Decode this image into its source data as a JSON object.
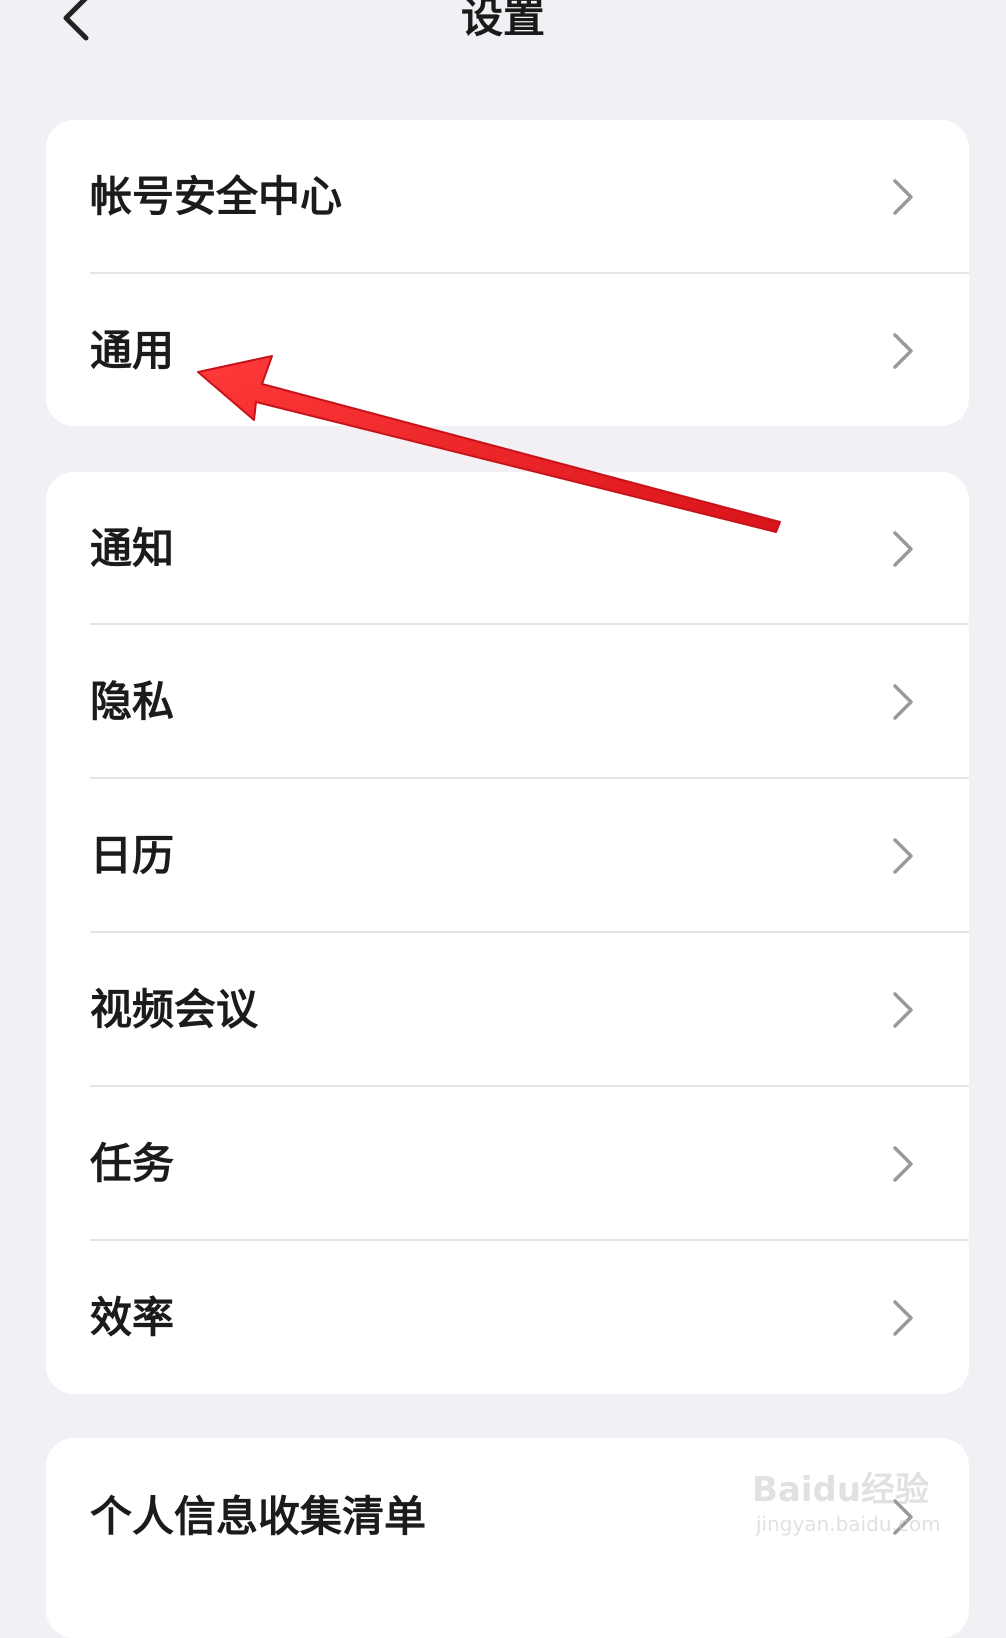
{
  "header": {
    "title": "设置",
    "back_icon": "chevron-left-icon"
  },
  "sections": [
    {
      "items": [
        {
          "label": "帐号安全中心",
          "icon": "chevron-right-icon"
        },
        {
          "label": "通用",
          "icon": "chevron-right-icon"
        }
      ]
    },
    {
      "items": [
        {
          "label": "通知",
          "icon": "chevron-right-icon"
        },
        {
          "label": "隐私",
          "icon": "chevron-right-icon"
        },
        {
          "label": "日历",
          "icon": "chevron-right-icon"
        },
        {
          "label": "视频会议",
          "icon": "chevron-right-icon"
        },
        {
          "label": "任务",
          "icon": "chevron-right-icon"
        },
        {
          "label": "效率",
          "icon": "chevron-right-icon"
        }
      ]
    },
    {
      "items": [
        {
          "label": "个人信息收集清单",
          "icon": "chevron-right-icon"
        }
      ]
    }
  ],
  "annotation": {
    "arrow_color": "#e8191e",
    "points_to": "通用"
  },
  "watermark": {
    "logo": "Baidu经验",
    "url": "jingyan.baidu.com"
  },
  "colors": {
    "background": "#f2f0f4",
    "card": "#ffffff",
    "text": "#1b1b1b",
    "chevron": "#9a9a9a"
  }
}
